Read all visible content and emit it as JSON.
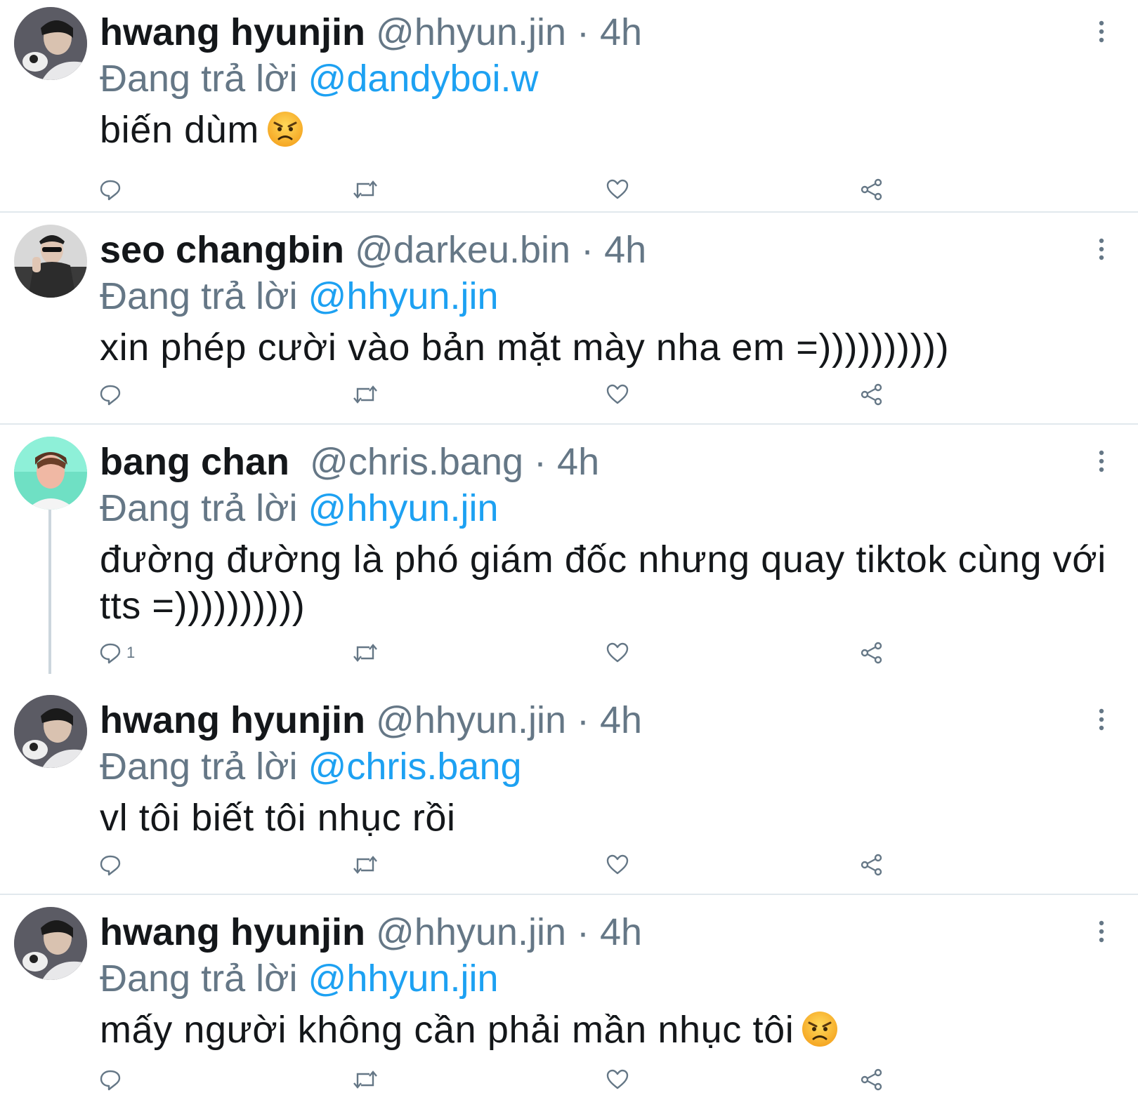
{
  "icons": {
    "reply": "reply-icon",
    "retweet": "retweet-icon",
    "like": "heart-icon",
    "share": "share-icon",
    "menu": "more-vertical-icon"
  },
  "colors": {
    "mention": "#1da1f2",
    "secondary": "#657786",
    "text": "#14171a",
    "divider": "#e1e8ed"
  },
  "tweets": [
    {
      "name": "hwang hyunjin",
      "handle": "@hhyun.jin",
      "sep": "·",
      "time": "4h",
      "reply_prefix": "Đang trả lời",
      "reply_to": "@dandyboi.w",
      "text": "biến dùm",
      "emoji": "angry-face-emoji",
      "reply_count": ""
    },
    {
      "name": "seo changbin",
      "handle": "@darkeu.bin",
      "sep": "·",
      "time": "4h",
      "reply_prefix": "Đang trả lời",
      "reply_to": "@hhyun.jin",
      "text": "xin phép cười vào bản mặt mày nha em =))))))))))",
      "reply_count": ""
    },
    {
      "name": "bang chan",
      "handle": "@chris.bang",
      "sep": "·",
      "time": "4h",
      "reply_prefix": "Đang trả lời",
      "reply_to": "@hhyun.jin",
      "text": "đường đường là phó giám đốc nhưng quay tiktok cùng với tts =))))))))))",
      "reply_count": "1"
    },
    {
      "name": "hwang hyunjin",
      "handle": "@hhyun.jin",
      "sep": "·",
      "time": "4h",
      "reply_prefix": "Đang trả lời",
      "reply_to": "@chris.bang",
      "text": "vl tôi biết tôi nhục rồi",
      "reply_count": ""
    },
    {
      "name": "hwang hyunjin",
      "handle": "@hhyun.jin",
      "sep": "·",
      "time": "4h",
      "reply_prefix": "Đang trả lời",
      "reply_to": "@hhyun.jin",
      "text": "mấy người không cần phải mần nhục tôi",
      "emoji": "angry-face-emoji",
      "reply_count": ""
    }
  ]
}
